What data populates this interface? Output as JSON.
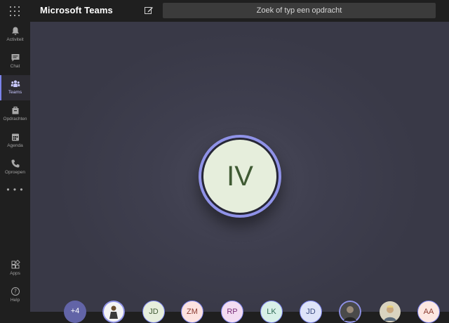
{
  "header": {
    "app_title": "Microsoft Teams",
    "search_placeholder": "Zoek of typ een opdracht",
    "icons": [
      "app-grid-icon",
      "compose-icon"
    ]
  },
  "rail": {
    "items": [
      {
        "label": "Activiteit",
        "icon": "bell-icon",
        "active": false
      },
      {
        "label": "Chat",
        "icon": "chat-icon",
        "active": false
      },
      {
        "label": "Teams",
        "icon": "teams-icon",
        "active": true
      },
      {
        "label": "Opdrachten",
        "icon": "assignments-icon",
        "active": false
      },
      {
        "label": "Agenda",
        "icon": "calendar-icon",
        "active": false
      },
      {
        "label": "Oproepen",
        "icon": "phone-icon",
        "active": false
      }
    ],
    "more_label": "• • •",
    "bottom_items": [
      {
        "label": "Apps",
        "icon": "apps-icon"
      },
      {
        "label": "Help",
        "icon": "help-icon"
      }
    ]
  },
  "call": {
    "active_speaker_initials": "IV",
    "participants": [
      {
        "initials": "+4",
        "bg": "#6264a7",
        "fg": "#ffffff"
      },
      {
        "initials": "",
        "bg": "#f0f0f0",
        "fg": "#333333"
      },
      {
        "initials": "JD",
        "bg": "#e6eedc",
        "fg": "#3f5a33"
      },
      {
        "initials": "ZM",
        "bg": "#fde3e0",
        "fg": "#8a3a30"
      },
      {
        "initials": "RP",
        "bg": "#f3dcf2",
        "fg": "#7a2f78"
      },
      {
        "initials": "LK",
        "bg": "#d8f0e8",
        "fg": "#2f6a55"
      },
      {
        "initials": "JD",
        "bg": "#dde3f8",
        "fg": "#3a4a7e"
      },
      {
        "initials": "",
        "bg": "#555555",
        "fg": "#ffffff"
      },
      {
        "initials": "",
        "bg": "#c9c2a8",
        "fg": "#333333"
      },
      {
        "initials": "AA",
        "bg": "#fde7e2",
        "fg": "#8a3a30"
      }
    ]
  },
  "colors": {
    "accent": "#7b83eb",
    "stage_bg": "#3f3f4f",
    "app_bg": "#1f1f1f"
  }
}
